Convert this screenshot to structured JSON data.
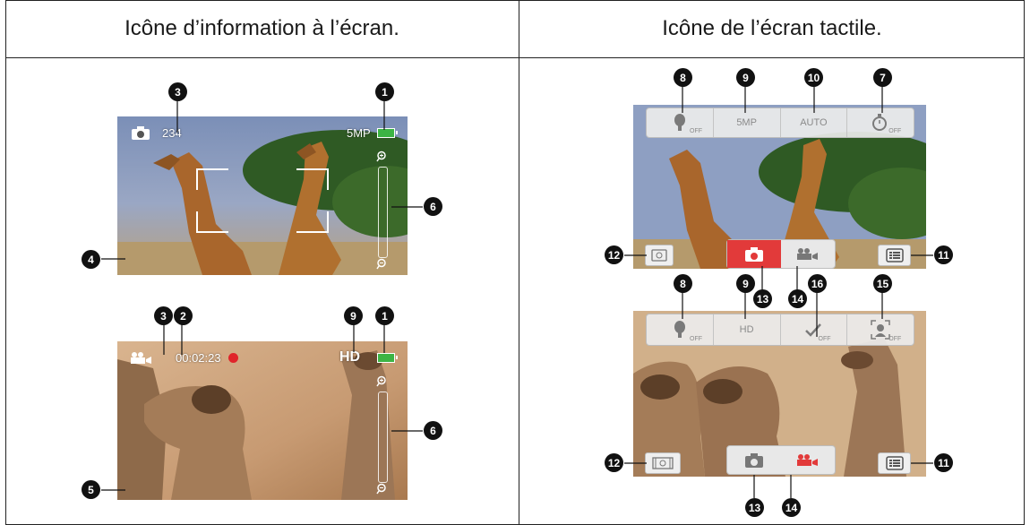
{
  "headers": {
    "left": "Icône d’information à l’écran.",
    "right": "Icône de l’écran tactile."
  },
  "photo_screen": {
    "shot_count": "234",
    "resolution": "5MP"
  },
  "video_screen": {
    "time": "00:02:23",
    "quality": "HD"
  },
  "photo_touch": {
    "items": [
      "OFF",
      "5MP",
      "AUTO",
      "OFF"
    ]
  },
  "video_touch": {
    "items": [
      "OFF",
      "HD",
      "OFF",
      "OFF"
    ]
  },
  "markers": {
    "m1": "1",
    "m2": "2",
    "m3": "3",
    "m4": "4",
    "m5": "5",
    "m6": "6",
    "m7": "7",
    "m8": "8",
    "m9": "9",
    "m10": "10",
    "m11": "11",
    "m12": "12",
    "m13": "13",
    "m14": "14",
    "m15": "15",
    "m16": "16"
  },
  "icons": [
    "camera-icon",
    "video-camera-icon",
    "battery-icon",
    "zoom-in-icon",
    "zoom-out-icon",
    "flash-icon",
    "self-timer-icon",
    "face-detect-icon",
    "stabilizer-icon",
    "playback-icon",
    "menu-icon"
  ],
  "colors": {
    "record_red": "#e0242a",
    "active_mode": "#e23a3a",
    "battery_green": "#3cb444"
  }
}
